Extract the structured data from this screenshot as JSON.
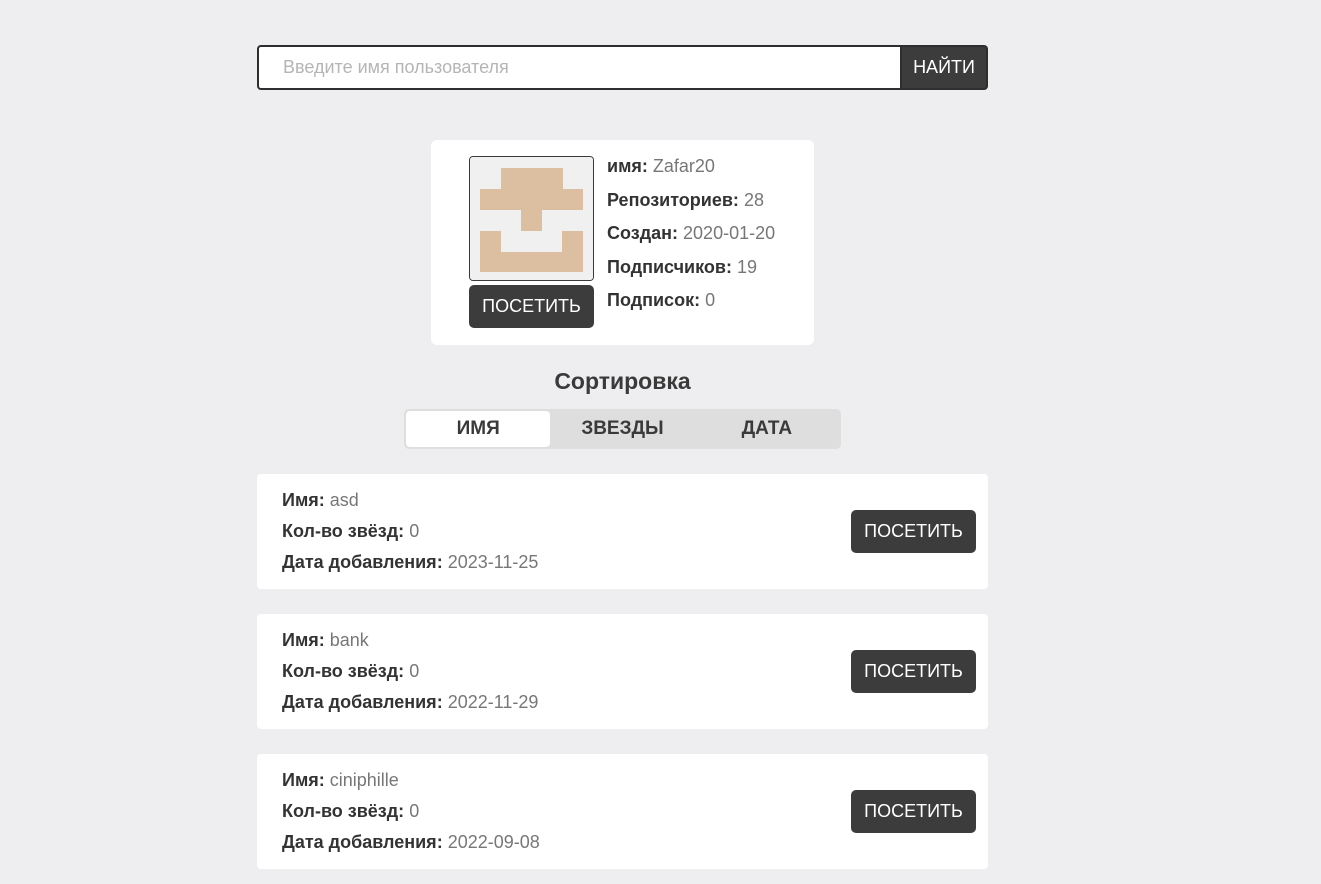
{
  "search": {
    "placeholder": "Введите имя пользователя",
    "value": "",
    "button_label": "НАЙТИ"
  },
  "user": {
    "avatar_icon": "identicon-avatar-icon",
    "avatar_color": "#dcbfa0",
    "visit_label": "ПОСЕТИТЬ",
    "fields": {
      "name_label": "имя:",
      "name_value": "Zafar20",
      "repos_label": "Репозиториев:",
      "repos_value": "28",
      "created_label": "Создан:",
      "created_value": "2020-01-20",
      "followers_label": "Подписчиков:",
      "followers_value": "19",
      "following_label": "Подписок:",
      "following_value": "0"
    }
  },
  "sort": {
    "title": "Сортировка",
    "options": [
      "ИМЯ",
      "ЗВЕЗДЫ",
      "ДАТА"
    ],
    "active": "ИМЯ"
  },
  "repo_labels": {
    "name": "Имя:",
    "stars": "Кол-во звёзд:",
    "date": "Дата добавления:",
    "visit": "ПОСЕТИТЬ"
  },
  "repos": [
    {
      "name": "asd",
      "stars": "0",
      "date": "2023-11-25"
    },
    {
      "name": "bank",
      "stars": "0",
      "date": "2022-11-29"
    },
    {
      "name": "ciniphille",
      "stars": "0",
      "date": "2022-09-08"
    }
  ]
}
